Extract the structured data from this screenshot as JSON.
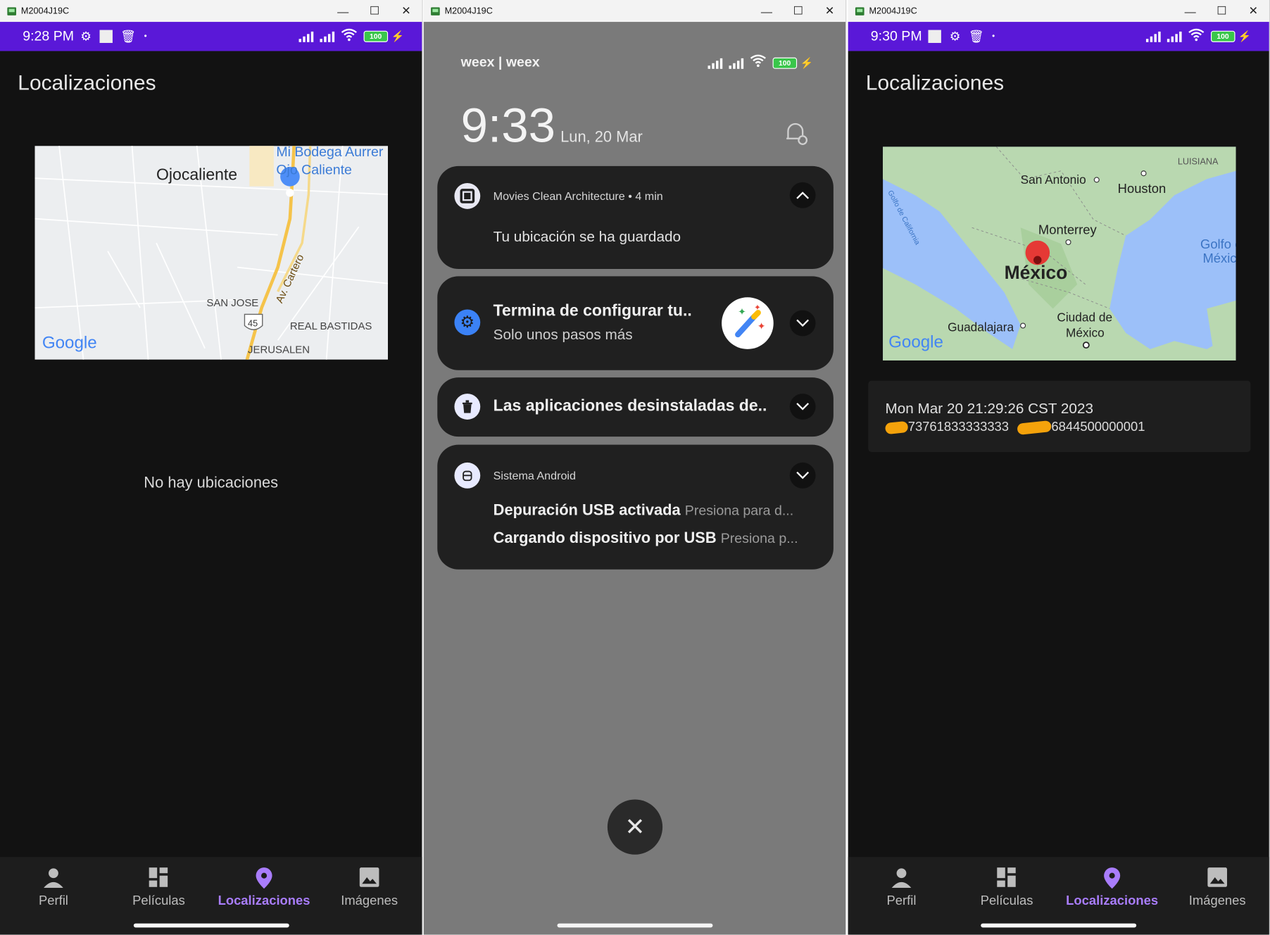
{
  "window_title": "M2004J19C",
  "window_buttons": {
    "minimize": "—",
    "maximize": "☐",
    "close": "✕"
  },
  "colors": {
    "status_bar": "#5a18d8",
    "app_background": "#121212",
    "accent": "#a97dfc",
    "shade": "#7a7a7a"
  },
  "left_screen": {
    "status_time": "9:28 PM",
    "battery": "100",
    "page_title": "Localizaciones",
    "map_labels": {
      "town": "Ojocaliente",
      "poi_line1": "Mi Bodega Aurrer",
      "poi_line2": "Ojo Caliente",
      "road": "Av. Cartero",
      "san_jose": "SAN JOSE",
      "shield": "45",
      "real_bastidas": "REAL BASTIDAS",
      "jerusalen": "JERUSALEN",
      "google": "Google"
    },
    "empty_text": "No hay ubicaciones"
  },
  "notification_shade": {
    "carrier": "weex | weex",
    "battery": "100",
    "clock": "9:33",
    "date": "Lun, 20 Mar",
    "notifications": [
      {
        "app": "Movies Clean Architecture",
        "time": "4 min",
        "message": "Tu ubicación se ha guardado"
      },
      {
        "title": "Termina de configurar tu..",
        "subtitle": "Solo unos pasos más"
      },
      {
        "title": "Las aplicaciones desinstaladas de.."
      },
      {
        "app": "Sistema Android",
        "line1": "Depuración USB activada",
        "line1_hint": "Presiona para d...",
        "line2": "Cargando dispositivo por USB",
        "line2_hint": "Presiona p..."
      }
    ],
    "dismiss_icon": "✕"
  },
  "right_screen": {
    "status_time": "9:30 PM",
    "battery": "100",
    "page_title": "Localizaciones",
    "map_labels": {
      "san_antonio": "San Antonio",
      "houston": "Houston",
      "luisiana": "LUISIANA",
      "monterrey": "Monterrey",
      "mexico": "México",
      "golfo_line1": "Golfo d",
      "golfo_line2": "Méxic",
      "golfo_california": "Golfo de California",
      "guadalajara": "Guadalajara",
      "ciudad_line1": "Ciudad de",
      "ciudad_line2": "México",
      "google": "Google"
    },
    "location": {
      "date": "Mon Mar 20 21:29:26 CST 2023",
      "lat_suffix": "73761833333333",
      "lng_suffix": "6844500000001"
    }
  },
  "bottom_nav": [
    {
      "label": "Perfil",
      "icon": "person-icon"
    },
    {
      "label": "Películas",
      "icon": "dashboard-icon"
    },
    {
      "label": "Localizaciones",
      "icon": "location-pin-icon",
      "active": true
    },
    {
      "label": "Imágenes",
      "icon": "image-icon"
    }
  ]
}
